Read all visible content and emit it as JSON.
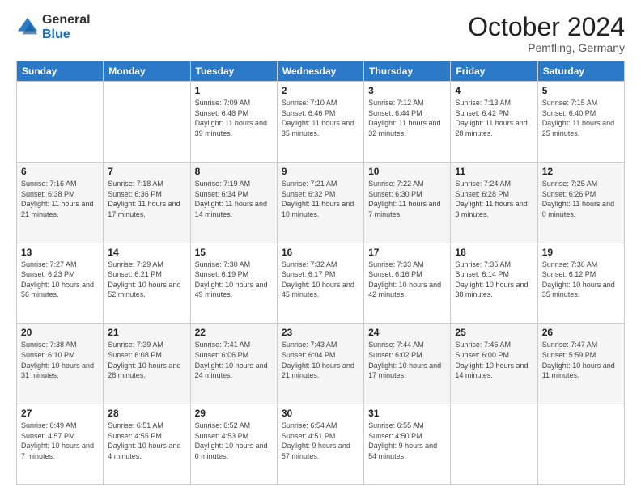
{
  "logo": {
    "general": "General",
    "blue": "Blue"
  },
  "header": {
    "month": "October 2024",
    "location": "Pemfling, Germany"
  },
  "weekdays": [
    "Sunday",
    "Monday",
    "Tuesday",
    "Wednesday",
    "Thursday",
    "Friday",
    "Saturday"
  ],
  "weeks": [
    [
      {
        "day": "",
        "sunrise": "",
        "sunset": "",
        "daylight": ""
      },
      {
        "day": "",
        "sunrise": "",
        "sunset": "",
        "daylight": ""
      },
      {
        "day": "1",
        "sunrise": "Sunrise: 7:09 AM",
        "sunset": "Sunset: 6:48 PM",
        "daylight": "Daylight: 11 hours and 39 minutes."
      },
      {
        "day": "2",
        "sunrise": "Sunrise: 7:10 AM",
        "sunset": "Sunset: 6:46 PM",
        "daylight": "Daylight: 11 hours and 35 minutes."
      },
      {
        "day": "3",
        "sunrise": "Sunrise: 7:12 AM",
        "sunset": "Sunset: 6:44 PM",
        "daylight": "Daylight: 11 hours and 32 minutes."
      },
      {
        "day": "4",
        "sunrise": "Sunrise: 7:13 AM",
        "sunset": "Sunset: 6:42 PM",
        "daylight": "Daylight: 11 hours and 28 minutes."
      },
      {
        "day": "5",
        "sunrise": "Sunrise: 7:15 AM",
        "sunset": "Sunset: 6:40 PM",
        "daylight": "Daylight: 11 hours and 25 minutes."
      }
    ],
    [
      {
        "day": "6",
        "sunrise": "Sunrise: 7:16 AM",
        "sunset": "Sunset: 6:38 PM",
        "daylight": "Daylight: 11 hours and 21 minutes."
      },
      {
        "day": "7",
        "sunrise": "Sunrise: 7:18 AM",
        "sunset": "Sunset: 6:36 PM",
        "daylight": "Daylight: 11 hours and 17 minutes."
      },
      {
        "day": "8",
        "sunrise": "Sunrise: 7:19 AM",
        "sunset": "Sunset: 6:34 PM",
        "daylight": "Daylight: 11 hours and 14 minutes."
      },
      {
        "day": "9",
        "sunrise": "Sunrise: 7:21 AM",
        "sunset": "Sunset: 6:32 PM",
        "daylight": "Daylight: 11 hours and 10 minutes."
      },
      {
        "day": "10",
        "sunrise": "Sunrise: 7:22 AM",
        "sunset": "Sunset: 6:30 PM",
        "daylight": "Daylight: 11 hours and 7 minutes."
      },
      {
        "day": "11",
        "sunrise": "Sunrise: 7:24 AM",
        "sunset": "Sunset: 6:28 PM",
        "daylight": "Daylight: 11 hours and 3 minutes."
      },
      {
        "day": "12",
        "sunrise": "Sunrise: 7:25 AM",
        "sunset": "Sunset: 6:26 PM",
        "daylight": "Daylight: 11 hours and 0 minutes."
      }
    ],
    [
      {
        "day": "13",
        "sunrise": "Sunrise: 7:27 AM",
        "sunset": "Sunset: 6:23 PM",
        "daylight": "Daylight: 10 hours and 56 minutes."
      },
      {
        "day": "14",
        "sunrise": "Sunrise: 7:29 AM",
        "sunset": "Sunset: 6:21 PM",
        "daylight": "Daylight: 10 hours and 52 minutes."
      },
      {
        "day": "15",
        "sunrise": "Sunrise: 7:30 AM",
        "sunset": "Sunset: 6:19 PM",
        "daylight": "Daylight: 10 hours and 49 minutes."
      },
      {
        "day": "16",
        "sunrise": "Sunrise: 7:32 AM",
        "sunset": "Sunset: 6:17 PM",
        "daylight": "Daylight: 10 hours and 45 minutes."
      },
      {
        "day": "17",
        "sunrise": "Sunrise: 7:33 AM",
        "sunset": "Sunset: 6:16 PM",
        "daylight": "Daylight: 10 hours and 42 minutes."
      },
      {
        "day": "18",
        "sunrise": "Sunrise: 7:35 AM",
        "sunset": "Sunset: 6:14 PM",
        "daylight": "Daylight: 10 hours and 38 minutes."
      },
      {
        "day": "19",
        "sunrise": "Sunrise: 7:36 AM",
        "sunset": "Sunset: 6:12 PM",
        "daylight": "Daylight: 10 hours and 35 minutes."
      }
    ],
    [
      {
        "day": "20",
        "sunrise": "Sunrise: 7:38 AM",
        "sunset": "Sunset: 6:10 PM",
        "daylight": "Daylight: 10 hours and 31 minutes."
      },
      {
        "day": "21",
        "sunrise": "Sunrise: 7:39 AM",
        "sunset": "Sunset: 6:08 PM",
        "daylight": "Daylight: 10 hours and 28 minutes."
      },
      {
        "day": "22",
        "sunrise": "Sunrise: 7:41 AM",
        "sunset": "Sunset: 6:06 PM",
        "daylight": "Daylight: 10 hours and 24 minutes."
      },
      {
        "day": "23",
        "sunrise": "Sunrise: 7:43 AM",
        "sunset": "Sunset: 6:04 PM",
        "daylight": "Daylight: 10 hours and 21 minutes."
      },
      {
        "day": "24",
        "sunrise": "Sunrise: 7:44 AM",
        "sunset": "Sunset: 6:02 PM",
        "daylight": "Daylight: 10 hours and 17 minutes."
      },
      {
        "day": "25",
        "sunrise": "Sunrise: 7:46 AM",
        "sunset": "Sunset: 6:00 PM",
        "daylight": "Daylight: 10 hours and 14 minutes."
      },
      {
        "day": "26",
        "sunrise": "Sunrise: 7:47 AM",
        "sunset": "Sunset: 5:59 PM",
        "daylight": "Daylight: 10 hours and 11 minutes."
      }
    ],
    [
      {
        "day": "27",
        "sunrise": "Sunrise: 6:49 AM",
        "sunset": "Sunset: 4:57 PM",
        "daylight": "Daylight: 10 hours and 7 minutes."
      },
      {
        "day": "28",
        "sunrise": "Sunrise: 6:51 AM",
        "sunset": "Sunset: 4:55 PM",
        "daylight": "Daylight: 10 hours and 4 minutes."
      },
      {
        "day": "29",
        "sunrise": "Sunrise: 6:52 AM",
        "sunset": "Sunset: 4:53 PM",
        "daylight": "Daylight: 10 hours and 0 minutes."
      },
      {
        "day": "30",
        "sunrise": "Sunrise: 6:54 AM",
        "sunset": "Sunset: 4:51 PM",
        "daylight": "Daylight: 9 hours and 57 minutes."
      },
      {
        "day": "31",
        "sunrise": "Sunrise: 6:55 AM",
        "sunset": "Sunset: 4:50 PM",
        "daylight": "Daylight: 9 hours and 54 minutes."
      },
      {
        "day": "",
        "sunrise": "",
        "sunset": "",
        "daylight": ""
      },
      {
        "day": "",
        "sunrise": "",
        "sunset": "",
        "daylight": ""
      }
    ]
  ]
}
